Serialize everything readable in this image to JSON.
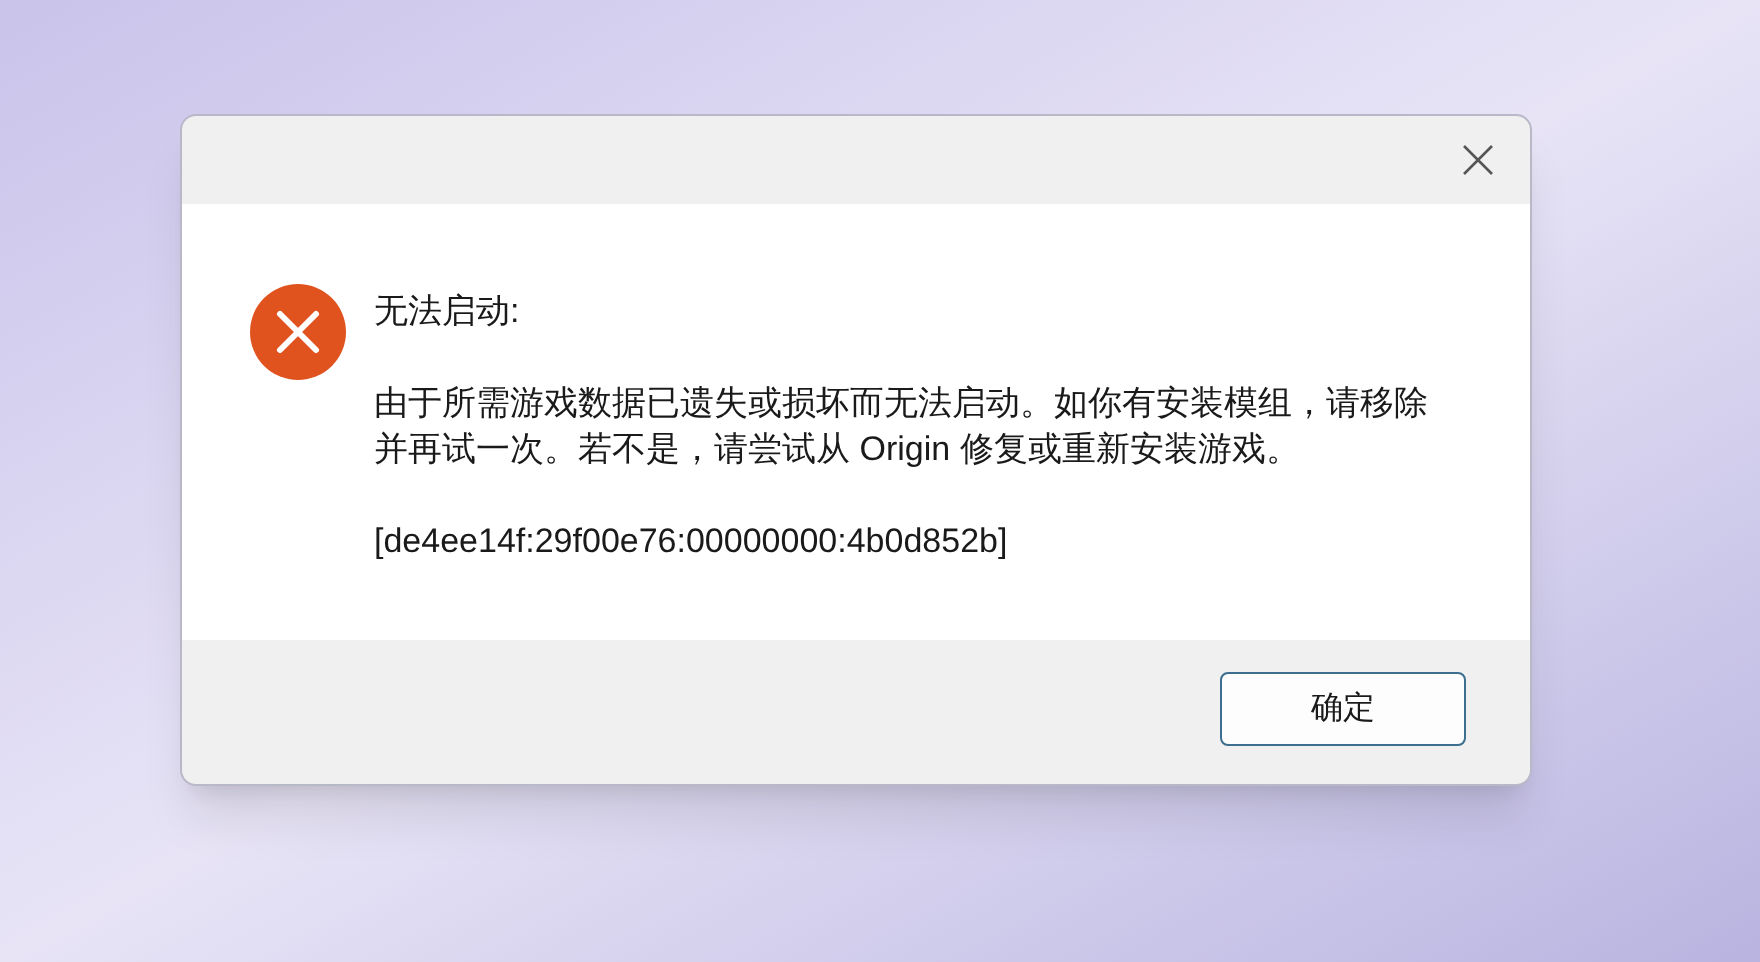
{
  "dialog": {
    "heading": "无法启动:",
    "message": "由于所需游戏数据已遗失或损坏而无法启动。如你有安装模组，请移除并再试一次。若不是，请尝试从 Origin 修复或重新安装游戏。",
    "error_code": "[de4ee14f:29f00e76:00000000:4b0d852b]",
    "buttons": [
      "确定"
    ]
  }
}
